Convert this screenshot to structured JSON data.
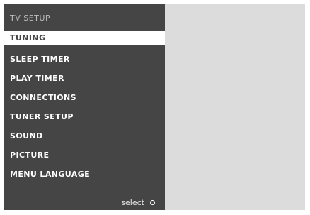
{
  "menu": {
    "title": "TV SETUP",
    "items": [
      {
        "label": "TUNING",
        "selected": true
      },
      {
        "label": "SLEEP TIMER",
        "selected": false
      },
      {
        "label": "PLAY TIMER",
        "selected": false
      },
      {
        "label": "CONNECTIONS",
        "selected": false
      },
      {
        "label": "TUNER SETUP",
        "selected": false
      },
      {
        "label": "SOUND",
        "selected": false
      },
      {
        "label": "PICTURE",
        "selected": false
      },
      {
        "label": "MENU LANGUAGE",
        "selected": false
      }
    ]
  },
  "hint": {
    "label": "select",
    "icon": "circle-icon"
  },
  "colors": {
    "menu_background": "#454545",
    "content_background": "#dcdcdc",
    "highlight": "#ffffff"
  }
}
